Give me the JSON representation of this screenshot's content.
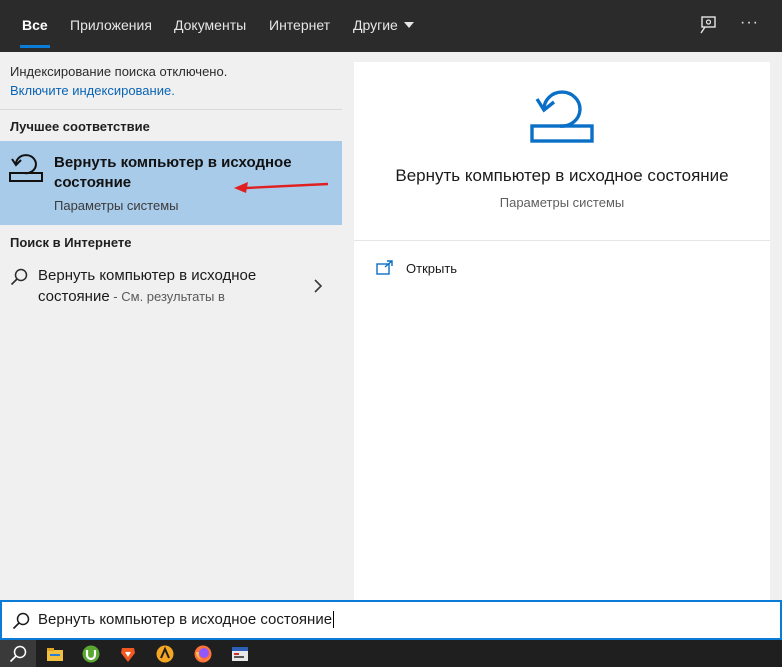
{
  "tabs": [
    {
      "label": "Все",
      "active": true
    },
    {
      "label": "Приложения"
    },
    {
      "label": "Документы"
    },
    {
      "label": "Интернет"
    },
    {
      "label": "Другие"
    }
  ],
  "header_icons": [
    "feedback-icon",
    "more-options-icon"
  ],
  "more_label": "···",
  "indexing": {
    "notice": "Индексирование поиска отключено.",
    "link": "Включите индексирование."
  },
  "best_match": {
    "header": "Лучшее соответствие",
    "title": "Вернуть компьютер в исходное состояние",
    "subtitle": "Параметры системы",
    "icon": "system-reset-icon"
  },
  "web_search": {
    "header": "Поиск в Интернете",
    "title": "Вернуть компьютер в исходное состояние",
    "suffix": " - См. результаты в"
  },
  "preview": {
    "title": "Вернуть компьютер в исходное состояние",
    "subtitle": "Параметры системы",
    "action_open": "Открыть"
  },
  "search": {
    "value": "Вернуть компьютер в исходное состояние"
  },
  "taskbar_apps": [
    "file-explorer-icon",
    "utorrent-icon",
    "brave-icon",
    "aimp-icon",
    "firefox-icon",
    "app-icon"
  ],
  "colors": {
    "accent": "#0a7bd6",
    "selection": "#a9cbea",
    "annotation_arrow": "#e02020",
    "tabbar": "#2b2b2b"
  }
}
